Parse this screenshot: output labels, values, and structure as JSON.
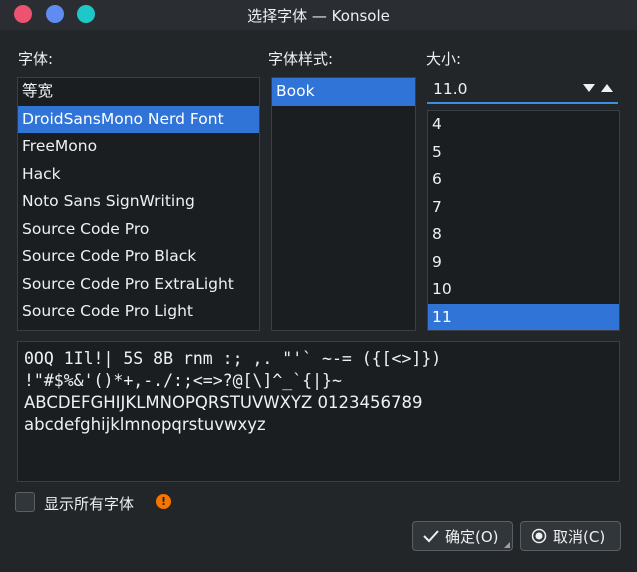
{
  "window": {
    "title": "选择字体 — Konsole"
  },
  "labels": {
    "font": "字体:",
    "style": "字体样式:",
    "size": "大小:"
  },
  "fonts": [
    {
      "label": "等宽",
      "selected": false
    },
    {
      "label": "DroidSansMono Nerd Font",
      "selected": true
    },
    {
      "label": "FreeMono",
      "selected": false
    },
    {
      "label": "Hack",
      "selected": false
    },
    {
      "label": "Noto Sans SignWriting",
      "selected": false
    },
    {
      "label": "Source Code Pro",
      "selected": false
    },
    {
      "label": "Source Code Pro Black",
      "selected": false
    },
    {
      "label": "Source Code Pro ExtraLight",
      "selected": false
    },
    {
      "label": "Source Code Pro Light",
      "selected": false
    }
  ],
  "styles": [
    {
      "label": "Book",
      "selected": true
    }
  ],
  "size": {
    "value": "11.0",
    "options": [
      {
        "label": "4",
        "selected": false
      },
      {
        "label": "5",
        "selected": false
      },
      {
        "label": "6",
        "selected": false
      },
      {
        "label": "7",
        "selected": false
      },
      {
        "label": "8",
        "selected": false
      },
      {
        "label": "9",
        "selected": false
      },
      {
        "label": "10",
        "selected": false
      },
      {
        "label": "11",
        "selected": true
      }
    ]
  },
  "preview": {
    "line1": "0OQ 1Il!| 5S 8B rnm :; ,. \"'` ~-= ({[<>]})",
    "line2": "!\"#$%&'()*+,-./:;<=>?@[\\]^_`{|}~",
    "line3": "ABCDEFGHIJKLMNOPQRSTUVWXYZ 0123456789",
    "line4": "abcdefghijklmnopqrstuvwxyz"
  },
  "show_all": {
    "label": "显示所有字体",
    "checked": false
  },
  "buttons": {
    "ok": "确定(O)",
    "cancel": "取消(C)"
  },
  "colors": {
    "selection": "#3074d8",
    "accent": "#3d8fe0",
    "warning": "#f67400"
  }
}
